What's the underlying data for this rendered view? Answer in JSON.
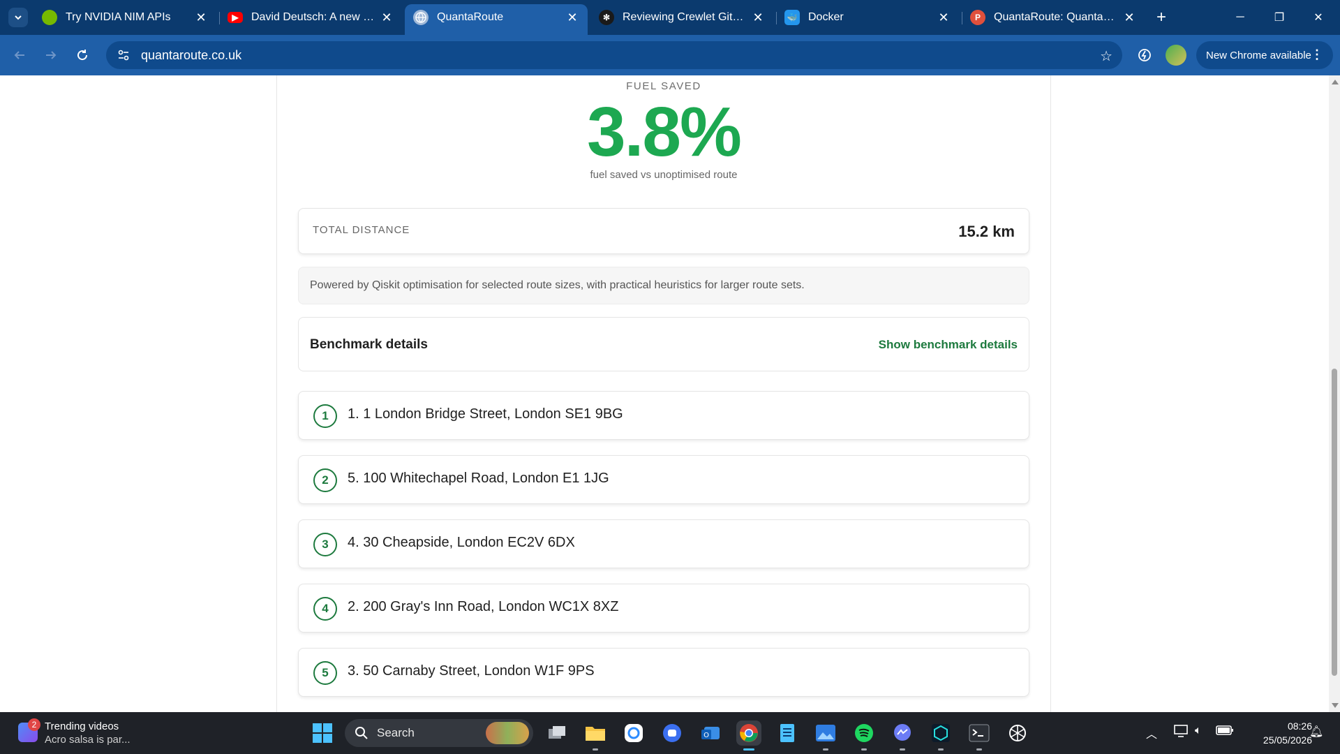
{
  "browser": {
    "tabs": [
      {
        "title": "Try NVIDIA NIM APIs",
        "favicon": "nvidia-icon",
        "color": "#76b900"
      },
      {
        "title": "David Deutsch: A new way",
        "favicon": "youtube-icon",
        "color": "#ff0000"
      },
      {
        "title": "QuantaRoute",
        "favicon": "globe-icon",
        "color": "#9fb8d8"
      },
      {
        "title": "Reviewing Crewlet GitHub",
        "favicon": "crewlet-icon",
        "color": "#222222"
      },
      {
        "title": "Docker",
        "favicon": "docker-icon",
        "color": "#2496ed"
      },
      {
        "title": "QuantaRoute: QuantaRoute",
        "favicon": "p-icon",
        "color": "#e0503c",
        "letter": "P"
      }
    ],
    "active_tab": 2,
    "url": "quantaroute.co.uk",
    "update_label": "New Chrome available"
  },
  "page": {
    "fuel": {
      "label": "FUEL SAVED",
      "value": "3.8%",
      "subtitle": "fuel saved vs unoptimised route",
      "color": "#1da851"
    },
    "distance": {
      "label": "TOTAL DISTANCE",
      "value": "15.2 km"
    },
    "note": "Powered by Qiskit optimisation for selected route sizes, with practical heuristics for larger route sets.",
    "benchmark": {
      "title": "Benchmark details",
      "toggle": "Show benchmark details"
    },
    "stops": [
      {
        "n": "1",
        "address": "1. 1 London Bridge Street, London SE1 9BG"
      },
      {
        "n": "2",
        "address": "5. 100 Whitechapel Road, London E1 1JG"
      },
      {
        "n": "3",
        "address": "4. 30 Cheapside, London EC2V 6DX"
      },
      {
        "n": "4",
        "address": "2. 200 Gray's Inn Road, London WC1X 8XZ"
      },
      {
        "n": "5",
        "address": "3. 50 Carnaby Street, London W1F 9PS"
      }
    ],
    "accent": "#1d7a3e"
  },
  "taskbar": {
    "widget": {
      "badge": "2",
      "title": "Trending videos",
      "subtitle": "Acro salsa is par..."
    },
    "search_label": "Search",
    "time": "08:26",
    "date": "25/05/2026"
  }
}
